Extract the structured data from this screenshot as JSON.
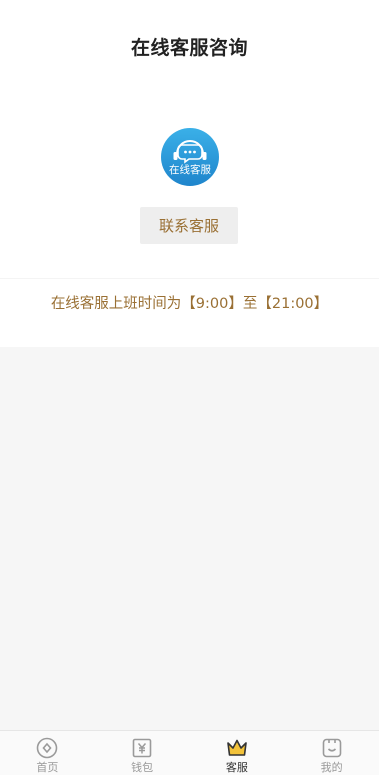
{
  "header": {
    "title": "在线客服咨询"
  },
  "service": {
    "logo_icon": "headset-chat-icon",
    "logo_text": "在线客服",
    "contact_button": "联系客服",
    "hours_text": "在线客服上班时间为【9:00】至【21:00】"
  },
  "tabbar": {
    "active": "客服",
    "items": [
      {
        "label": "首页",
        "icon": "home-icon"
      },
      {
        "label": "钱包",
        "icon": "wallet-icon"
      },
      {
        "label": "客服",
        "icon": "crown-icon"
      },
      {
        "label": "我的",
        "icon": "profile-icon"
      }
    ]
  },
  "colors": {
    "accent": "#9a7034",
    "logo_blue": "#2f9fe0",
    "crown": "#f2c23a",
    "inactive": "#999999"
  }
}
